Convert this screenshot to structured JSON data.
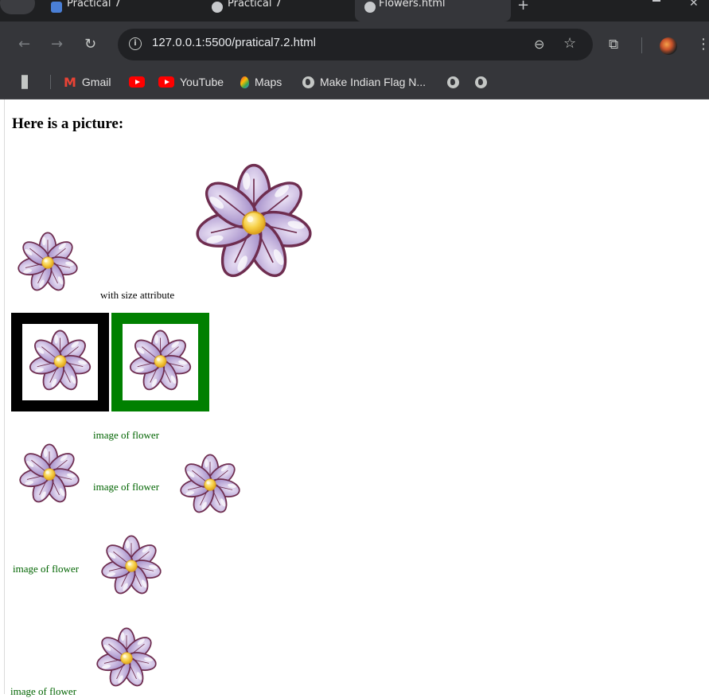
{
  "browser": {
    "tabs": [
      {
        "title": "Practical 7"
      },
      {
        "title": "Practical 7"
      },
      {
        "title": "Flowers.html"
      }
    ],
    "new_tab_label": "+",
    "url": "127.0.0.1:5500/pratical7.2.html",
    "bookmarks": [
      {
        "label": "Gmail",
        "icon": "gmail-icon"
      },
      {
        "label": "",
        "icon": "youtube-icon"
      },
      {
        "label": "YouTube",
        "icon": "youtube-icon"
      },
      {
        "label": "Maps",
        "icon": "maps-icon"
      },
      {
        "label": "Make Indian Flag N...",
        "icon": "globe-icon"
      },
      {
        "label": "",
        "icon": "globe-icon"
      },
      {
        "label": "",
        "icon": "globe-icon"
      }
    ]
  },
  "page": {
    "heading": "Here is a picture:",
    "size_caption": "with size attribute",
    "flower_caption": "image of flower",
    "colors": {
      "petal": "#c4b5dc",
      "petal_outline": "#6e2d4f",
      "center": "#f5c542",
      "frame_black": "#000000",
      "frame_green": "#008000",
      "caption_green": "#006400"
    }
  }
}
